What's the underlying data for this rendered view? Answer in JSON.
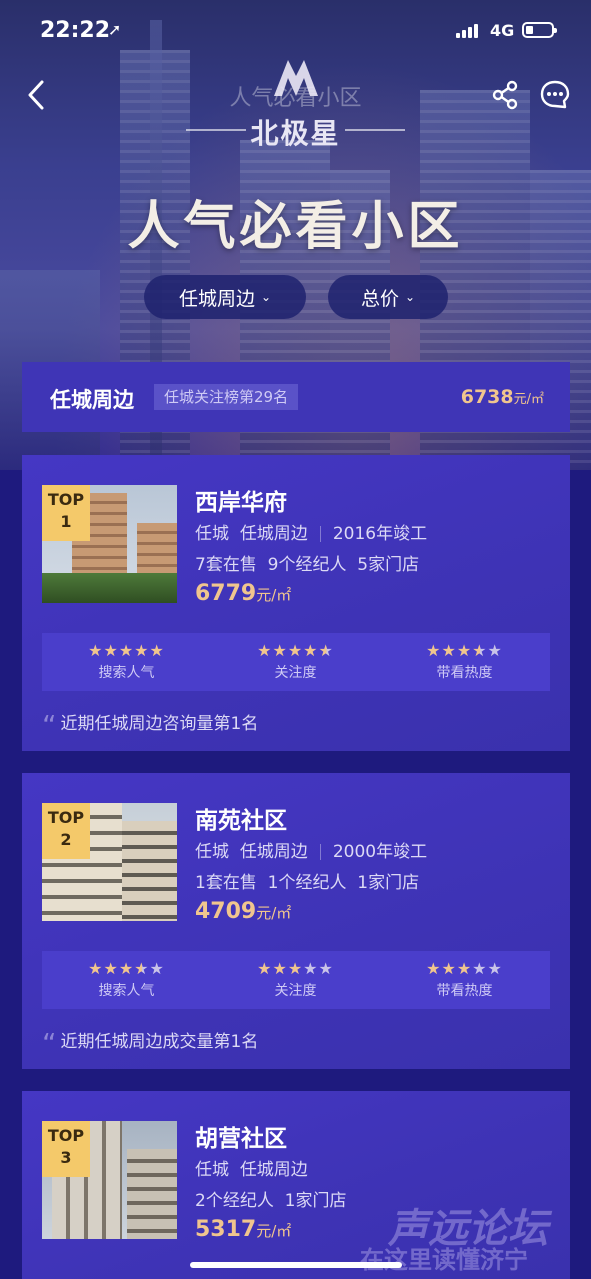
{
  "status": {
    "time": "22:22",
    "network": "4G"
  },
  "nav": {
    "title": "人气必看小区"
  },
  "brand": {
    "name": "北极星"
  },
  "hero": {
    "headline": "人气必看小区"
  },
  "filters": [
    {
      "label": "任城周边"
    },
    {
      "label": "总价"
    }
  ],
  "region": {
    "name": "任城周边",
    "rank": "任城关注榜第29名",
    "price": "6738",
    "unit": "元/㎡"
  },
  "metric_labels": [
    "搜索人气",
    "关注度",
    "带看热度"
  ],
  "communities": [
    {
      "top": "TOP",
      "rank": "1",
      "name": "西岸华府",
      "district": "任城",
      "area": "任城周边",
      "built": "2016年竣工",
      "stats": [
        "7套在售",
        "9个经纪人",
        "5家门店"
      ],
      "price": "6779",
      "unit": "元/㎡",
      "ratings": [
        5,
        4.5,
        3.5
      ],
      "note": "近期任城周边咨询量第1名"
    },
    {
      "top": "TOP",
      "rank": "2",
      "name": "南苑社区",
      "district": "任城",
      "area": "任城周边",
      "built": "2000年竣工",
      "stats": [
        "1套在售",
        "1个经纪人",
        "1家门店"
      ],
      "price": "4709",
      "unit": "元/㎡",
      "ratings": [
        3.5,
        3,
        3
      ],
      "note": "近期任城周边成交量第1名"
    },
    {
      "top": "TOP",
      "rank": "3",
      "name": "胡营社区",
      "district": "任城",
      "area": "任城周边",
      "stats": [
        "2个经纪人",
        "1家门店"
      ],
      "price": "5317",
      "unit": "元/㎡"
    }
  ],
  "watermark": {
    "line1": "声远论坛",
    "line2": "在这里读懂济宁"
  },
  "colors": {
    "accent_gold": "#f0c58e",
    "card_bg": "#4537c4",
    "page_bg": "#1e1a7e"
  }
}
